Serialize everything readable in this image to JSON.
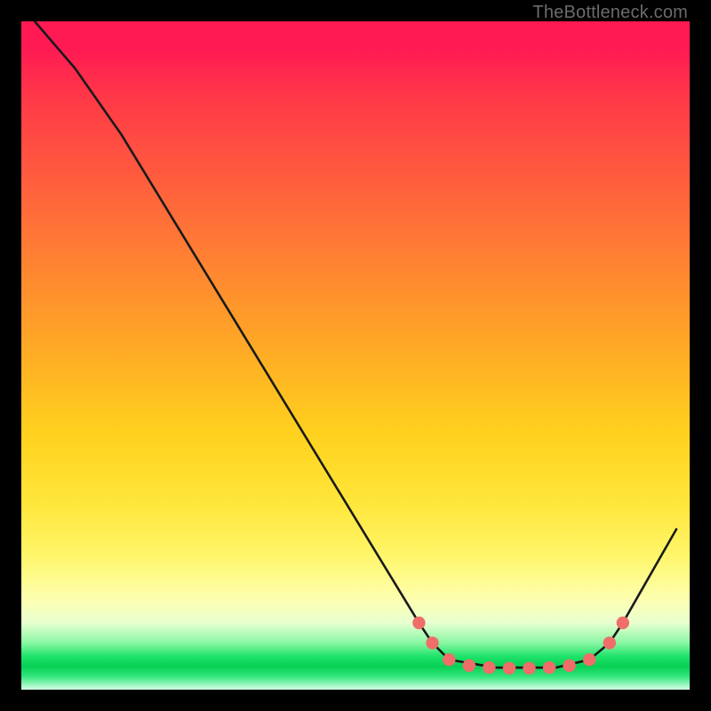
{
  "attribution": "TheBottleneck.com",
  "colors": {
    "background": "#000000",
    "gradient_top": "#ff1a53",
    "gradient_mid": "#ffd21e",
    "gradient_green": "#06d054",
    "curve_stroke": "#1a1a1a",
    "marker_fill": "#ef6e6a"
  },
  "chart_data": {
    "type": "line",
    "title": "",
    "xlabel": "",
    "ylabel": "",
    "xlim": [
      0,
      100
    ],
    "ylim": [
      0,
      100
    ],
    "curve": [
      {
        "x": 2,
        "y": 100
      },
      {
        "x": 8,
        "y": 93
      },
      {
        "x": 15,
        "y": 83
      },
      {
        "x": 40,
        "y": 42
      },
      {
        "x": 59.5,
        "y": 10
      },
      {
        "x": 61.5,
        "y": 7
      },
      {
        "x": 64,
        "y": 4.5
      },
      {
        "x": 71,
        "y": 3.3
      },
      {
        "x": 80,
        "y": 3.3
      },
      {
        "x": 85,
        "y": 4.5
      },
      {
        "x": 88,
        "y": 7
      },
      {
        "x": 90,
        "y": 10
      },
      {
        "x": 98,
        "y": 24
      }
    ],
    "markers": [
      {
        "x": 59.5,
        "y": 10
      },
      {
        "x": 61.5,
        "y": 7
      },
      {
        "x": 64,
        "y": 4.5
      },
      {
        "x": 67,
        "y": 3.6
      },
      {
        "x": 70,
        "y": 3.3
      },
      {
        "x": 73,
        "y": 3.2
      },
      {
        "x": 76,
        "y": 3.2
      },
      {
        "x": 79,
        "y": 3.3
      },
      {
        "x": 82,
        "y": 3.6
      },
      {
        "x": 85,
        "y": 4.5
      },
      {
        "x": 88,
        "y": 7
      },
      {
        "x": 90,
        "y": 10
      }
    ]
  }
}
